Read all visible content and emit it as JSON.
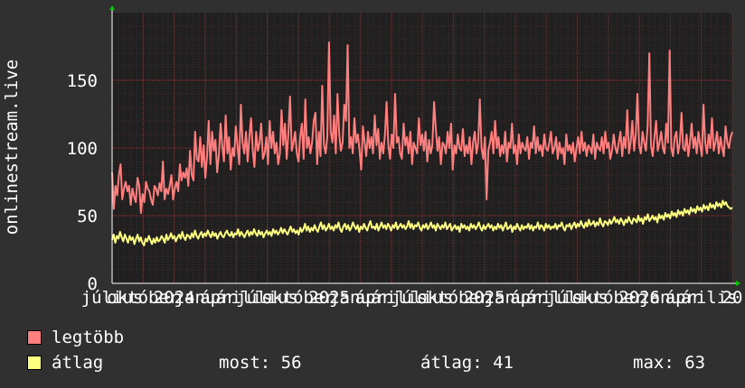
{
  "chart_data": {
    "type": "line",
    "ylabel": "onlinestream.live",
    "ylim": [
      0,
      200
    ],
    "yticks": [
      0,
      50,
      100,
      150
    ],
    "xtick_labels": [
      "július",
      "október",
      "2024",
      "január",
      "április",
      "július",
      "október",
      "2025",
      "január",
      "április",
      "július",
      "október",
      "2025",
      "január",
      "április",
      "július",
      "október",
      "2026",
      "január",
      "április",
      "20"
    ],
    "series": [
      {
        "name": "legtöbb",
        "color": "#ff7f7f",
        "values": [
          82,
          55,
          72,
          65,
          80,
          88,
          62,
          70,
          75,
          68,
          72,
          58,
          70,
          64,
          60,
          78,
          72,
          52,
          66,
          60,
          75,
          70,
          68,
          62,
          58,
          72,
          70,
          65,
          74,
          68,
          90,
          62,
          70,
          66,
          72,
          80,
          62,
          70,
          75,
          68,
          88,
          76,
          82,
          78,
          85,
          72,
          98,
          80,
          76,
          112,
          92,
          90,
          108,
          86,
          102,
          78,
          94,
          120,
          88,
          112,
          98,
          106,
          82,
          95,
          118,
          102,
          90,
          124,
          96,
          108,
          84,
          100,
          94,
          116,
          102,
          88,
          132,
          104,
          96,
          112,
          90,
          108,
          122,
          98,
          86,
          112,
          98,
          104,
          118,
          92,
          96,
          108,
          88,
          120,
          100,
          112,
          96,
          104,
          88,
          96,
          128,
          102,
          118,
          92,
          110,
          138,
          98,
          104,
          112,
          96,
          90,
          108,
          118,
          92,
          136,
          100,
          108,
          96,
          104,
          120,
          126,
          88,
          112,
          94,
          146,
          102,
          96,
          108,
          178,
          112,
          104,
          124,
          96,
          140,
          110,
          98,
          104,
          132,
          120,
          176,
          100,
          108,
          96,
          122,
          104,
          110,
          98,
          84,
          116,
          104,
          94,
          112,
          100,
          108,
          96,
          124,
          102,
          114,
          92,
          104,
          96,
          110,
          134,
          102,
          92,
          110,
          100,
          140,
          104,
          108,
          96,
          92,
          118,
          102,
          108,
          96,
          112,
          88,
          104,
          100,
          96,
          122,
          102,
          110,
          98,
          112,
          90,
          106,
          96,
          102,
          134,
          114,
          98,
          108,
          88,
          104,
          102,
          96,
          112,
          100,
          118,
          84,
          102,
          96,
          110,
          100,
          98,
          114,
          94,
          102,
          96,
          108,
          88,
          104,
          112,
          96,
          104,
          136,
          100,
          92,
          108,
          62,
          98,
          104,
          112,
          96,
          120,
          100,
          108,
          94,
          102,
          96,
          112,
          90,
          104,
          100,
          118,
          96,
          102,
          88,
          110,
          96,
          104,
          100,
          98,
          108,
          92,
          104,
          100,
          116,
          96,
          108,
          98,
          102,
          94,
          110,
          100,
          98,
          104,
          112,
          96,
          100,
          108,
          92,
          104,
          96,
          100,
          88,
          110,
          98,
          102,
          96,
          104,
          90,
          100,
          108,
          96,
          112,
          98,
          104,
          94,
          102,
          100,
          96,
          110,
          92,
          104,
          100,
          98,
          108,
          96,
          112,
          100,
          104,
          92,
          98,
          110,
          100,
          96,
          104,
          112,
          94,
          108,
          100,
          128,
          96,
          104,
          120,
          98,
          110,
          140,
          102,
          96,
          112,
          104,
          98,
          116,
          170,
          102,
          94,
          108,
          120,
          98,
          104,
          112,
          100,
          96,
          118,
          104,
          172,
          100,
          94,
          108,
          112,
          96,
          104,
          126,
          100,
          98,
          110,
          94,
          104,
          118,
          100,
          108,
          96,
          112,
          102,
          94,
          132,
          104,
          96,
          110,
          100,
          122,
          98,
          104,
          112,
          96,
          108,
          100,
          94,
          116,
          104,
          100,
          108,
          112
        ]
      },
      {
        "name": "átlag",
        "color": "#ffff80",
        "values": [
          32,
          36,
          30,
          35,
          33,
          38,
          34,
          31,
          36,
          33,
          30,
          35,
          32,
          34,
          29,
          33,
          36,
          31,
          34,
          30,
          28,
          33,
          31,
          35,
          32,
          29,
          33,
          30,
          34,
          31,
          32,
          35,
          33,
          30,
          36,
          32,
          34,
          37,
          33,
          35,
          31,
          34,
          36,
          33,
          38,
          34,
          32,
          36,
          35,
          33,
          37,
          34,
          39,
          35,
          33,
          36,
          38,
          34,
          37,
          35,
          39,
          36,
          34,
          38,
          35,
          37,
          33,
          36,
          38,
          35,
          34,
          37,
          39,
          36,
          35,
          38,
          34,
          37,
          36,
          40,
          35,
          38,
          36,
          34,
          37,
          39,
          35,
          38,
          36,
          40,
          37,
          35,
          39,
          36,
          38,
          34,
          37,
          39,
          36,
          38,
          35,
          40,
          37,
          39,
          36,
          38,
          41,
          37,
          40,
          38,
          36,
          39,
          42,
          38,
          40,
          37,
          39,
          36,
          41,
          38,
          40,
          44,
          39,
          42,
          38,
          41,
          39,
          43,
          40,
          38,
          42,
          45,
          40,
          43,
          39,
          41,
          44,
          40,
          42,
          39,
          43,
          41,
          45,
          40,
          38,
          42,
          44,
          40,
          43,
          39,
          41,
          45,
          42,
          40,
          43,
          38,
          42,
          40,
          44,
          41,
          39,
          43,
          46,
          41,
          42,
          40,
          44,
          39,
          42,
          45,
          41,
          43,
          40,
          44,
          42,
          39,
          43,
          41,
          45,
          40,
          42,
          44,
          41,
          43,
          40,
          42,
          46,
          41,
          44,
          40,
          43,
          42,
          45,
          41,
          39,
          43,
          41,
          44,
          40,
          42,
          45,
          41,
          43,
          39,
          44,
          42,
          40,
          43,
          41,
          45,
          40,
          42,
          44,
          39,
          41,
          43,
          40,
          42,
          38,
          44,
          41,
          43,
          40,
          42,
          39,
          44,
          41,
          43,
          40,
          42,
          45,
          41,
          39,
          43,
          40,
          42,
          44,
          41,
          43,
          39,
          42,
          40,
          44,
          41,
          43,
          39,
          42,
          45,
          40,
          41,
          43,
          38,
          42,
          40,
          44,
          41,
          39,
          43,
          40,
          42,
          41,
          44,
          40,
          43,
          39,
          42,
          41,
          45,
          40,
          43,
          42,
          39,
          44,
          41,
          43,
          40,
          42,
          41,
          44,
          40,
          43,
          42,
          45,
          41,
          39,
          43,
          42,
          44,
          40,
          43,
          45,
          41,
          44,
          42,
          46,
          43,
          41,
          45,
          42,
          47,
          43,
          44,
          46,
          42,
          45,
          43,
          48,
          44,
          42,
          46,
          45,
          43,
          47,
          44,
          46,
          49,
          45,
          47,
          44,
          48,
          46,
          43,
          47,
          45,
          49,
          46,
          44,
          48,
          47,
          45,
          50,
          46,
          48,
          44,
          49,
          47,
          51,
          46,
          48,
          50,
          47,
          49,
          45,
          51,
          48,
          50,
          47,
          52,
          49,
          51,
          48,
          53,
          50,
          52,
          49,
          54,
          51,
          53,
          50,
          55,
          52,
          54,
          51,
          56,
          53,
          55,
          52,
          57,
          54,
          56,
          53,
          58,
          55,
          57,
          54,
          59,
          56,
          58,
          55,
          60,
          57,
          59,
          56,
          61,
          58,
          60,
          57,
          56,
          55,
          56
        ]
      }
    ],
    "legend": [
      {
        "label": "legtöbb",
        "color": "#ff7f7f"
      },
      {
        "label": "átlag",
        "color": "#ffff80"
      }
    ],
    "stats": {
      "most": "most: 56",
      "atlag": "átlag: 41",
      "max": "max: 63"
    }
  }
}
